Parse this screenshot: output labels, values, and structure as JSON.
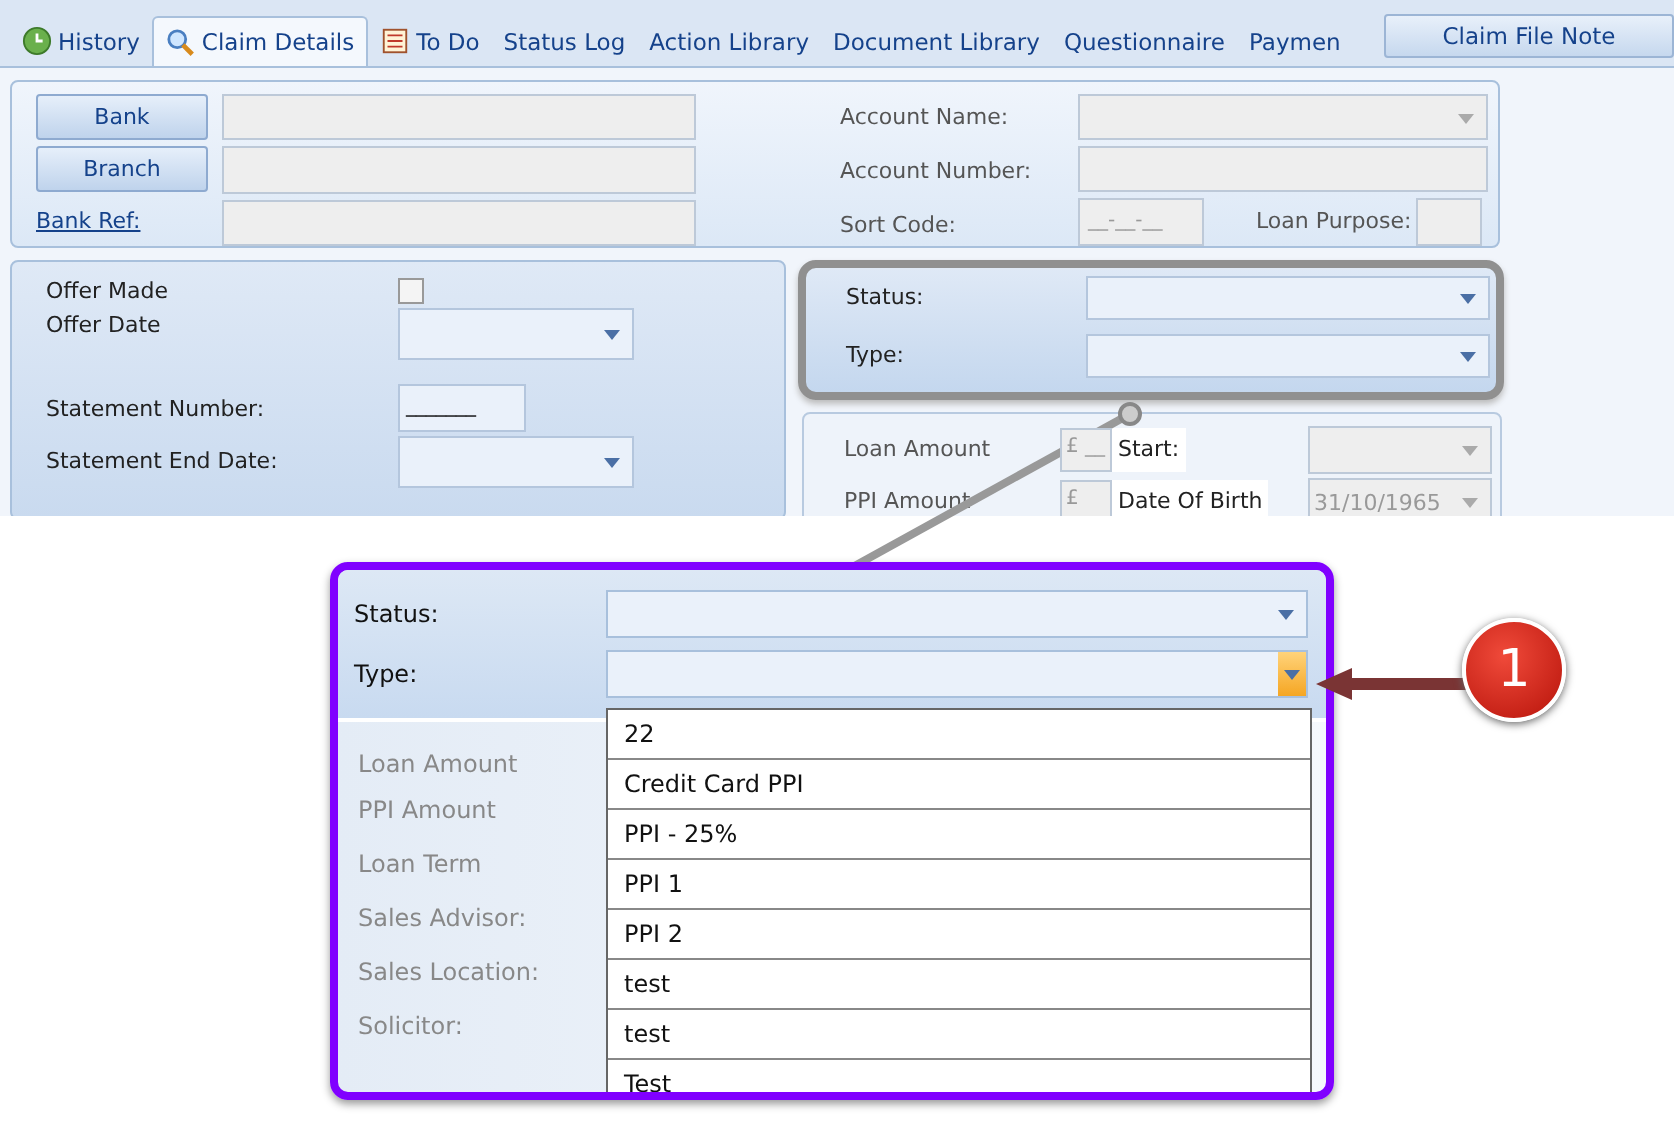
{
  "tabs": [
    {
      "label": "History",
      "selected": false
    },
    {
      "label": "Claim Details",
      "selected": true
    },
    {
      "label": "To Do",
      "selected": false
    },
    {
      "label": "Status Log",
      "selected": false
    },
    {
      "label": "Action Library",
      "selected": false
    },
    {
      "label": "Document Library",
      "selected": false
    },
    {
      "label": "Questionnaire",
      "selected": false
    },
    {
      "label": "Paymen",
      "selected": false
    }
  ],
  "side_button": "Claim File Note",
  "bank": {
    "buttons": [
      "Bank",
      "Branch"
    ],
    "link": "Bank Ref:"
  },
  "account": {
    "name_label": "Account Name:",
    "number_label": "Account Number:",
    "sort_label": "Sort Code:",
    "sort_value": "__-__-__",
    "purpose_label": "Loan Purpose:"
  },
  "offer": {
    "made_label": "Offer Made",
    "made_checked": false,
    "date_label": "Offer Date",
    "statement_label": "Statement Number:",
    "statement_value": "_______",
    "end_label": "Statement End Date:"
  },
  "status_panel": {
    "status_label": "Status:",
    "type_label": "Type:"
  },
  "loan": {
    "amount_label": "Loan Amount",
    "amount_value": "£ __",
    "start_label": "Start:",
    "ppi_label": "PPI Amount",
    "ppi_value": "£",
    "dob_label": "Date Of Birth",
    "dob_value": "31/10/1965"
  },
  "callout": {
    "status_label": "Status:",
    "type_label": "Type:",
    "labels": [
      "Loan Amount",
      "PPI Amount",
      "Loan Term",
      "Sales Advisor:",
      "Sales Location:",
      "Solicitor:"
    ],
    "options": [
      "22",
      "Credit Card PPI",
      "PPI - 25%",
      "PPI 1",
      "PPI 2",
      "test",
      "test",
      "Test"
    ],
    "badge": "1"
  }
}
